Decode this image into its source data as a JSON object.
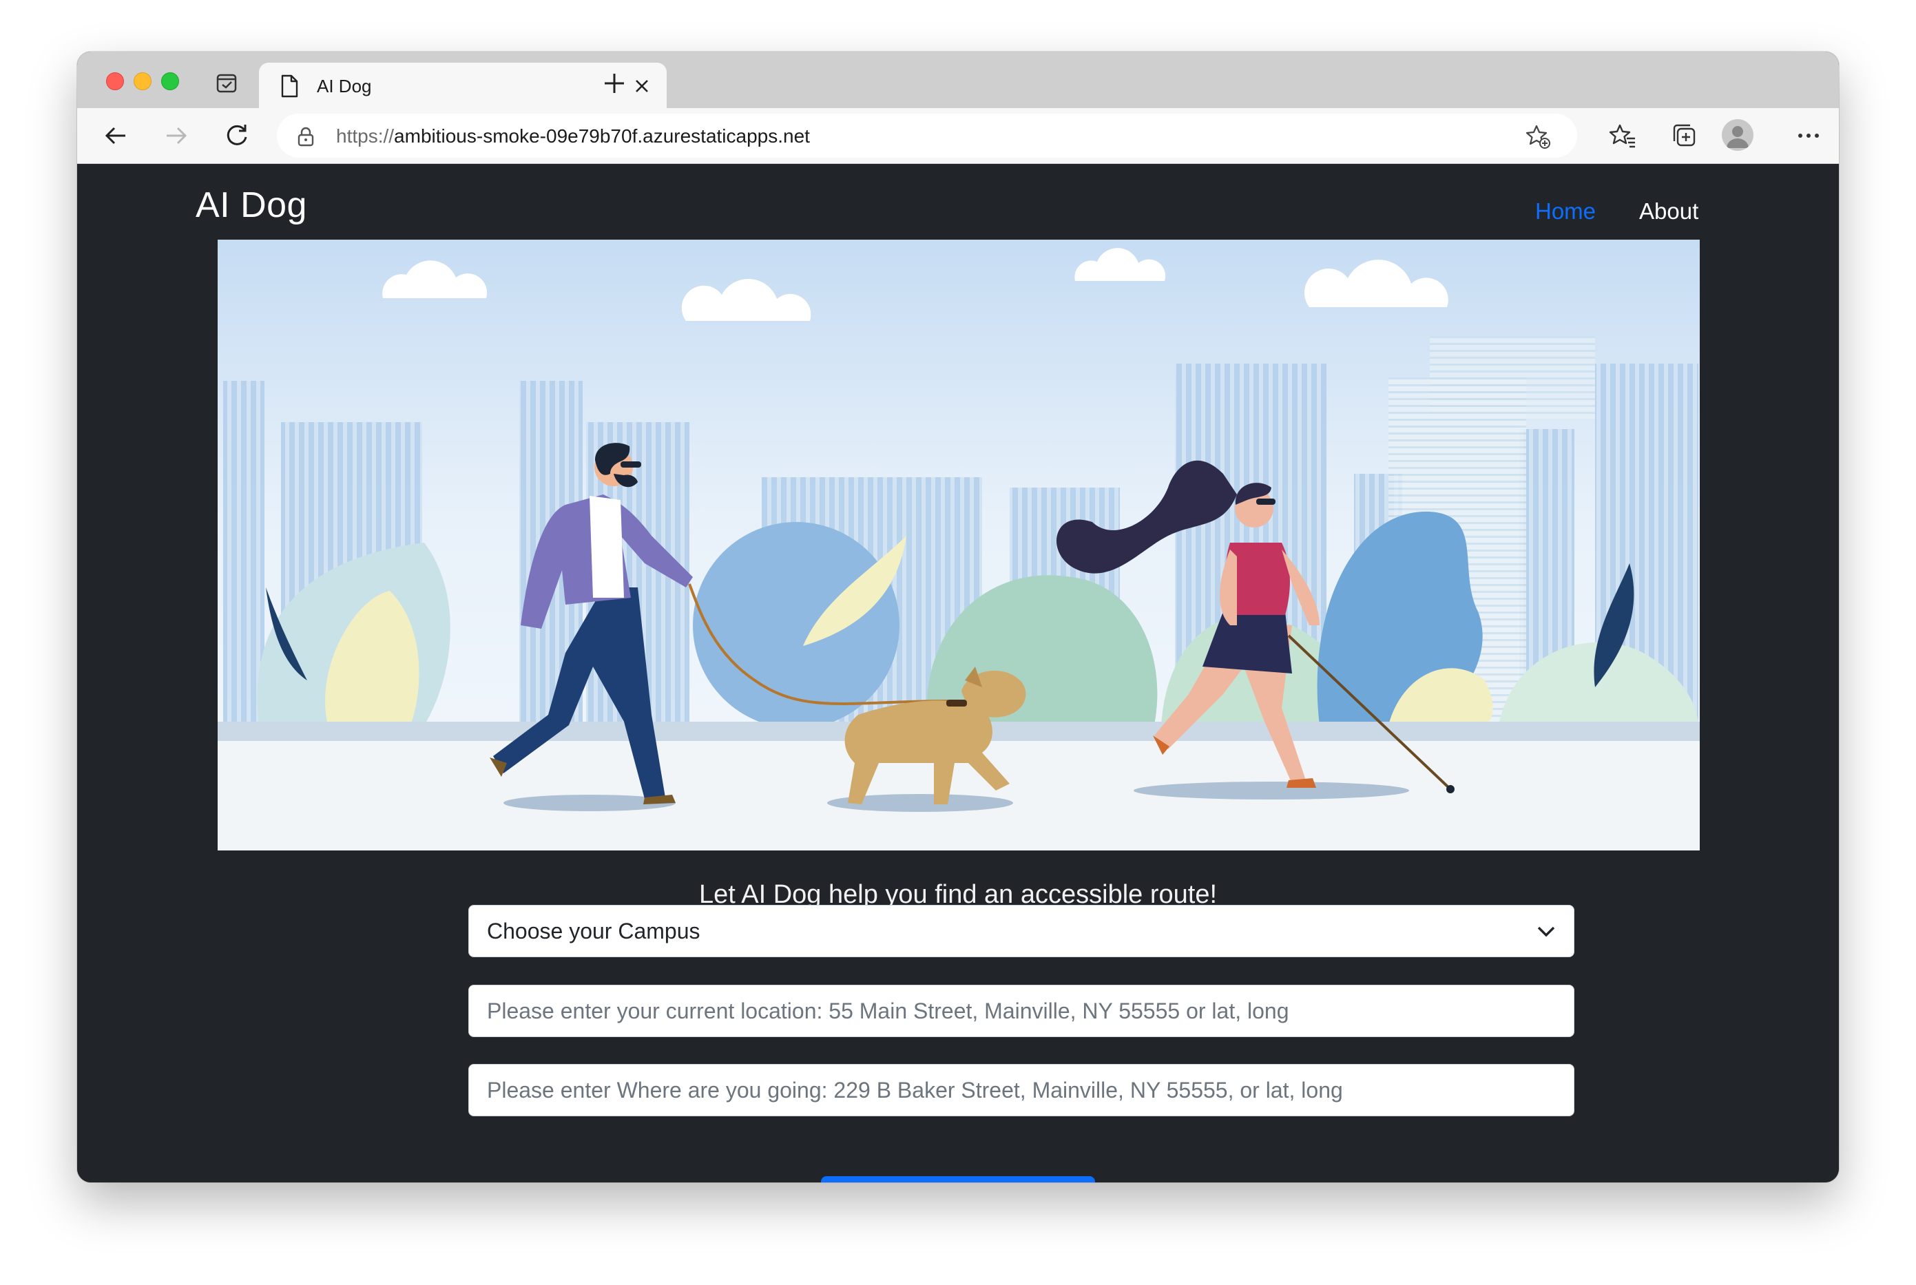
{
  "browser": {
    "tab_title": "AI Dog",
    "url_scheme": "https://",
    "url_host": "ambitious-smoke-09e79b70f.azurestaticapps.net"
  },
  "site": {
    "brand": "AI Dog",
    "nav": {
      "home": "Home",
      "about": "About"
    },
    "active_nav": "Home",
    "accent_color": "#0d6efd",
    "background_color": "#212529"
  },
  "main": {
    "tagline": "Let AI Dog help you find an accessible route!",
    "campus_select": {
      "selected": "Choose your Campus"
    },
    "origin_input": {
      "placeholder": "Please enter your current location: 55 Main Street, Mainville, NY 55555 or lat, long",
      "value": ""
    },
    "destination_input": {
      "placeholder": "Please enter Where are you going: 229 B Baker Street, Mainville, NY 55555, or lat, long",
      "value": ""
    }
  },
  "icons": {
    "tab_actions": "tab-actions-icon",
    "tab_page": "page-icon",
    "tab_close": "close-icon",
    "new_tab": "plus-icon",
    "back": "back-arrow-icon",
    "forward": "forward-arrow-icon",
    "refresh": "refresh-icon",
    "lock": "lock-icon",
    "add_favorite": "star-plus-icon",
    "favorites": "favorites-icon",
    "collections": "collections-icon",
    "profile": "profile-avatar-icon",
    "more": "more-dots-icon",
    "select_chevron": "chevron-down-icon"
  }
}
